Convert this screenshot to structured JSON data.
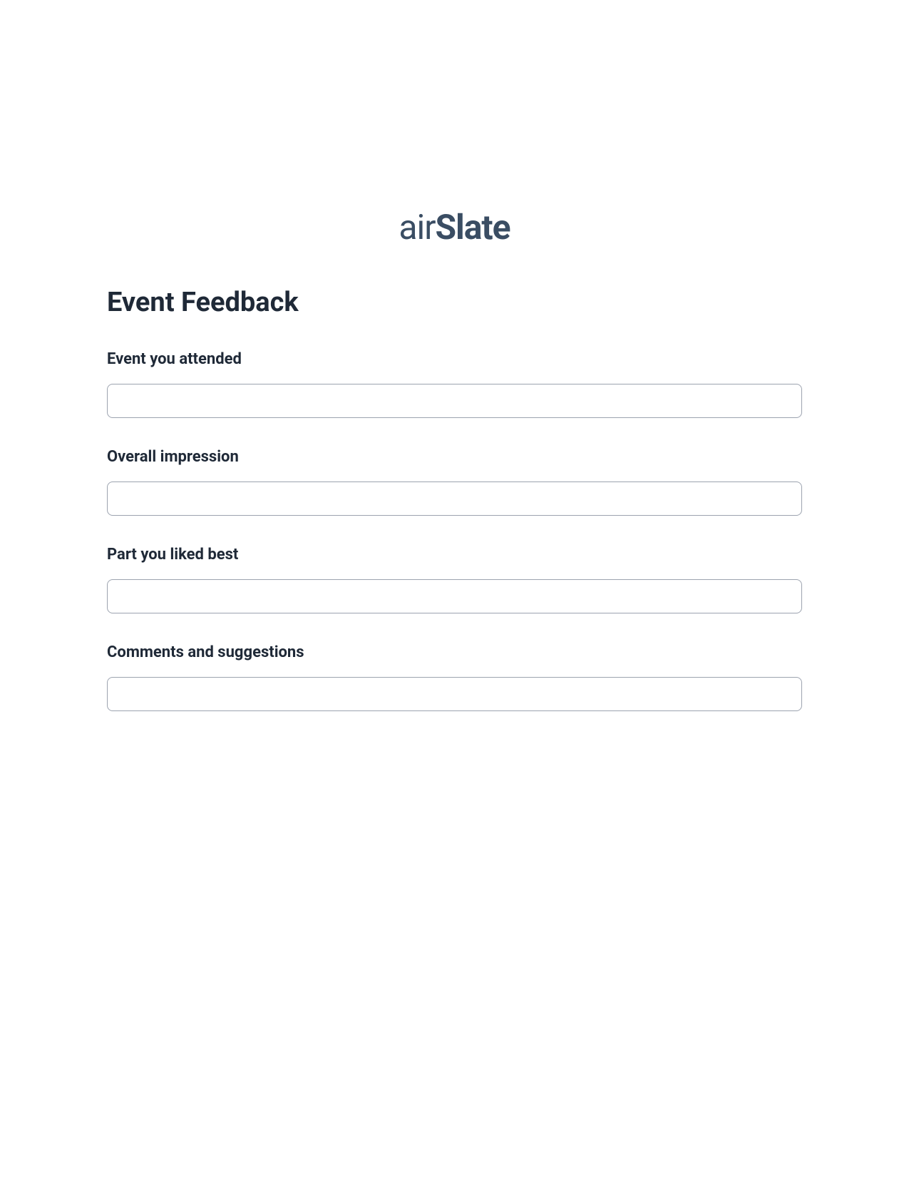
{
  "logo": {
    "part1": "air",
    "part2": "Slate"
  },
  "form": {
    "title": "Event Feedback",
    "fields": [
      {
        "label": "Event you attended",
        "value": ""
      },
      {
        "label": "Overall impression",
        "value": ""
      },
      {
        "label": "Part you liked best",
        "value": ""
      },
      {
        "label": "Comments and suggestions",
        "value": ""
      }
    ]
  }
}
